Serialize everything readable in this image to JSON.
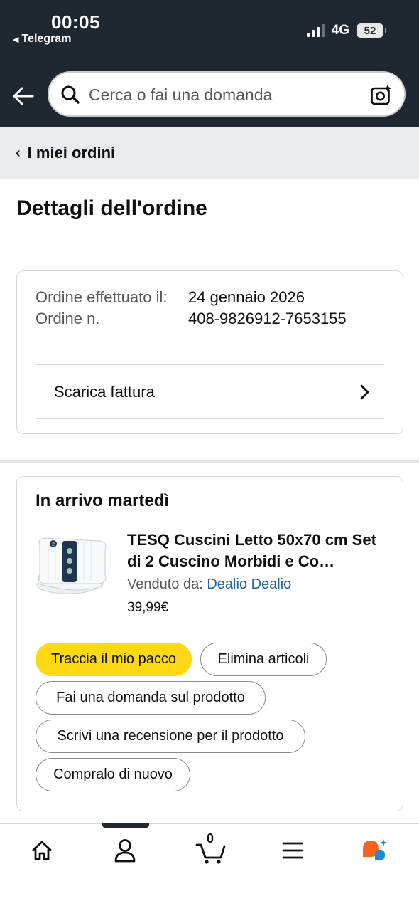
{
  "status_bar": {
    "time": "00:05",
    "back_app": "Telegram",
    "network": "4G",
    "battery": "52"
  },
  "search": {
    "placeholder": "Cerca o fai una domanda"
  },
  "breadcrumb": {
    "label": "I miei ordini"
  },
  "page": {
    "title": "Dettagli dell'ordine"
  },
  "order_info": {
    "placed_label": "Ordine effettuato il:",
    "number_label": "Ordine n.",
    "placed_value": "24 gennaio 2026",
    "number_value": "408-9826912-7653155",
    "invoice_label": "Scarica fattura"
  },
  "shipment": {
    "title": "In arrivo martedì",
    "product_name": "TESQ Cuscini Letto 50x70 cm Set di 2 Cuscino Morbidi e Co…",
    "seller_prefix": "Venduto da: ",
    "seller_name": "Dealio Dealio",
    "price": "39,99€",
    "buttons": {
      "track": "Traccia il mio pacco",
      "delete": "Elimina articoli",
      "ask": "Fai una domanda sul prodotto",
      "review": "Scrivi una recensione per il prodotto",
      "buy_again": "Compralo di nuovo"
    }
  },
  "tabbar": {
    "cart_count": "0",
    "icons": [
      "home-icon",
      "account-icon",
      "cart-icon",
      "menu-icon",
      "rufus-ai-icon"
    ]
  },
  "colors": {
    "header_bg": "#1f2731",
    "primary_button": "#ffd814",
    "link": "#2162a1",
    "rufus_orange": "#f7631b",
    "rufus_blue": "#1a8bd6"
  }
}
